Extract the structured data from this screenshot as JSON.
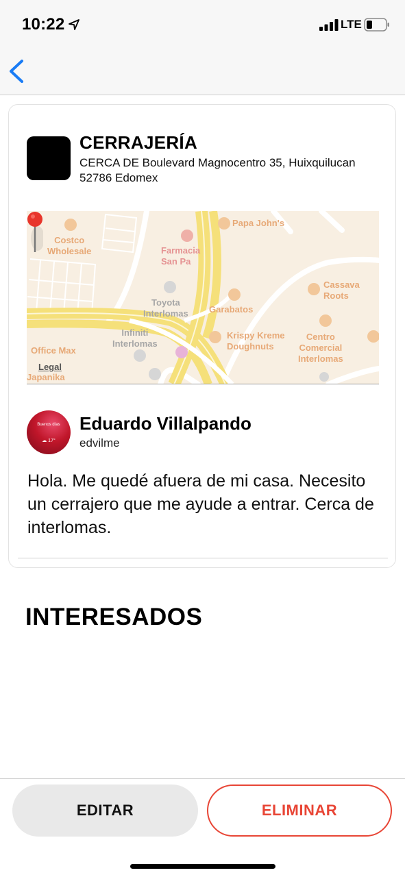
{
  "status_bar": {
    "time": "10:22",
    "network": "LTE"
  },
  "business": {
    "name": "CERRAJERÍA",
    "address": "CERCA DE Boulevard Magnocentro 35, Huixquilucan 52786 Edomex"
  },
  "map": {
    "labels": {
      "papa_johns": "Papa John's",
      "costco": "Costco\nWholesale",
      "farmacia": "Farmacia\nSan Pa",
      "toyota": "Toyota\nInterlomas",
      "garabatos": "Garabatos",
      "cassava": "Cassava\nRoots",
      "infiniti": "Infiniti\nInterlomas",
      "krispy": "Krispy Kreme\nDoughnuts",
      "centro": "Centro\nComercial\nInterlomas",
      "office_max": "Office Max",
      "japanika": "Japanika"
    },
    "legal": "Legal"
  },
  "user": {
    "name": "Eduardo Villalpando",
    "handle": "edvilme",
    "avatar_greeting": "Buenos días",
    "avatar_temp": "☁ 17°"
  },
  "message": "Hola. Me quedé afuera de mi casa. Necesito un cerrajero que me ayude a entrar. Cerca de interlomas.",
  "section_title": "INTERESADOS",
  "actions": {
    "edit_label": "EDITAR",
    "delete_label": "ELIMINAR"
  },
  "colors": {
    "accent_blue": "#1a7cf5",
    "danger": "#e84535",
    "pin": "#e8352b"
  },
  "icons": {
    "back": "chevron-left-icon",
    "location": "location-arrow-icon",
    "signal": "signal-icon",
    "battery": "battery-icon",
    "pin": "map-pin-icon"
  }
}
